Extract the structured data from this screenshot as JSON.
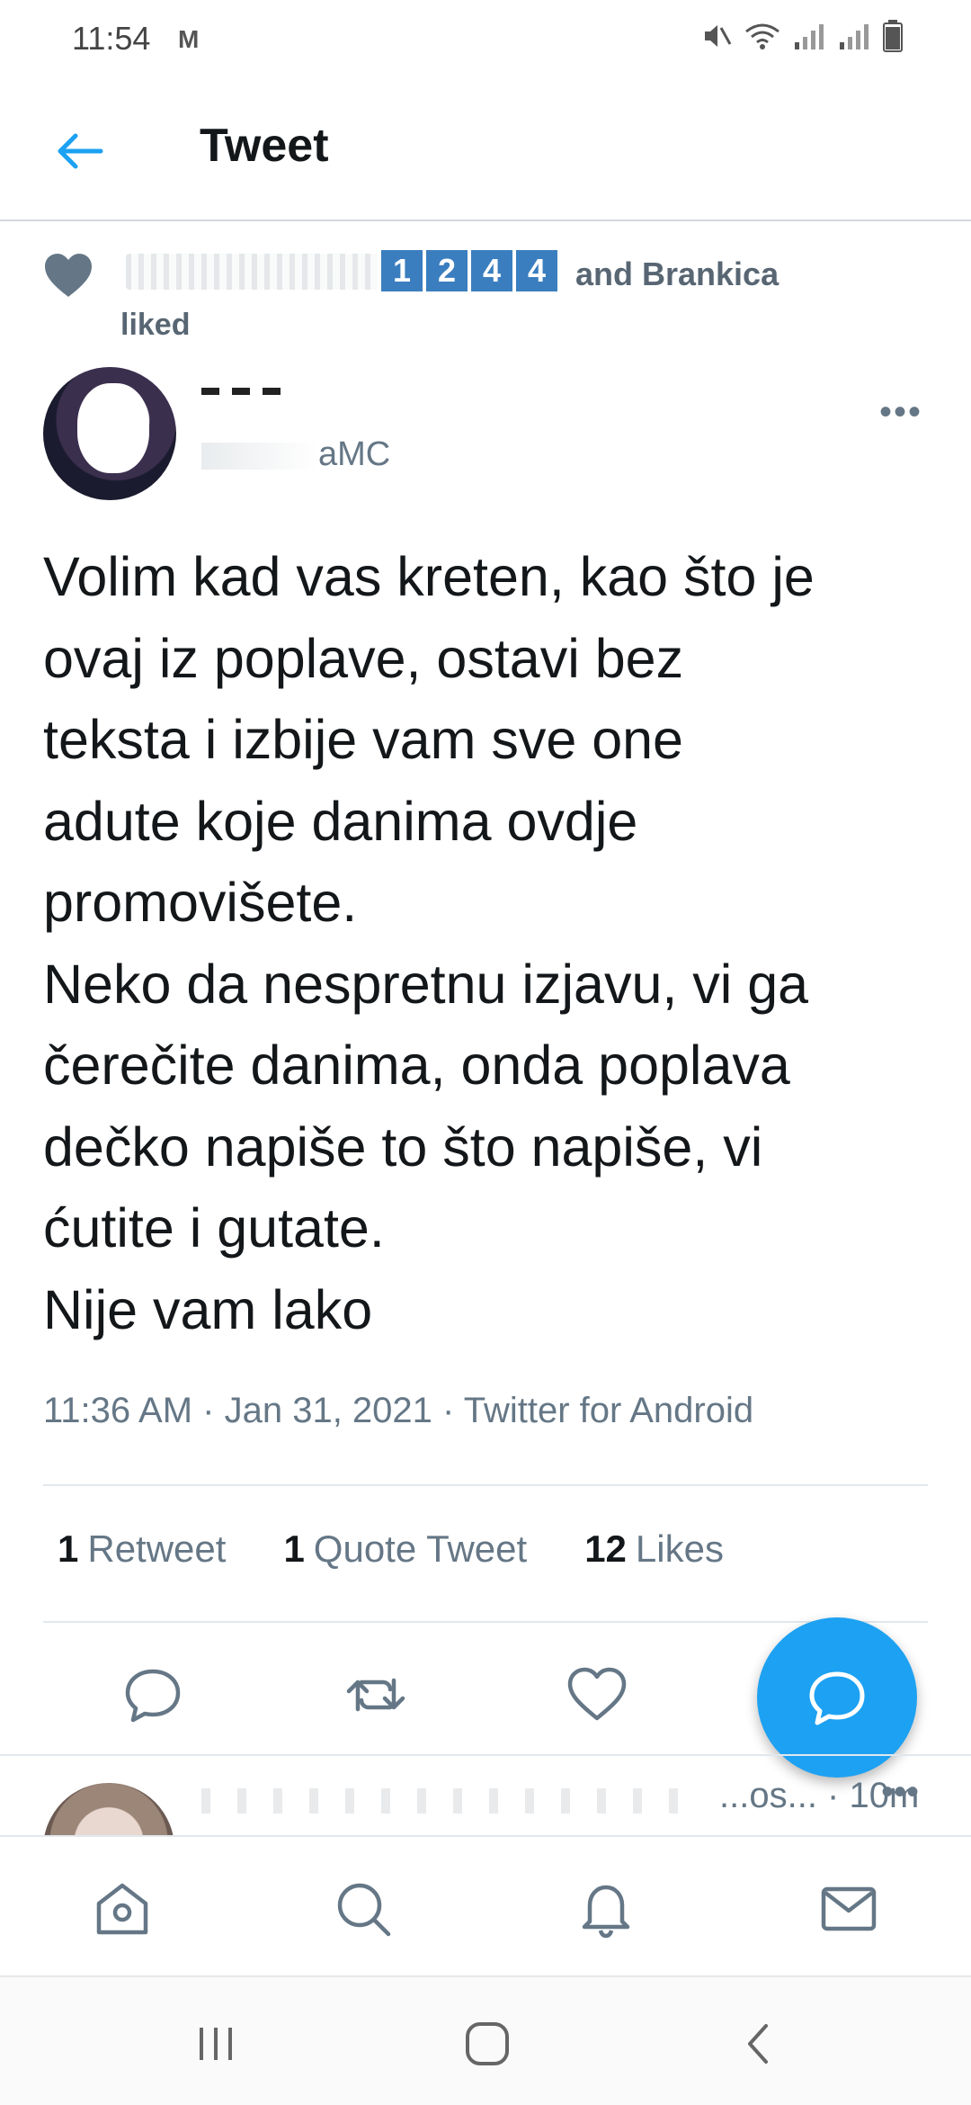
{
  "status_bar": {
    "time": "11:54",
    "mail_icon": "M",
    "icons": [
      "mute-icon",
      "wifi-icon",
      "signal-icon",
      "signal-icon",
      "battery-icon"
    ]
  },
  "header": {
    "title": "Tweet",
    "back_icon": "arrow-left-icon"
  },
  "social_context": {
    "badges": [
      "1",
      "2",
      "4",
      "4"
    ],
    "text": "and Brankica",
    "liked": "liked"
  },
  "tweet": {
    "handle_suffix": "aMC",
    "text": "Volim kad vas kreten, kao što je\novaj iz poplave, ostavi bez\nteksta i izbije vam sve one\nadute koje danima ovdje\npromovišete.\nNeko da nespretnu izjavu, vi ga\nčerečite danima, onda poplava\ndečko napiše to što napiše, vi\nćutite i gutate.\nNije vam lako",
    "time": "11:36 AM",
    "date": "Jan 31, 2021",
    "source": "Twitter for Android",
    "stats": [
      {
        "num": "1",
        "label": "Retweet"
      },
      {
        "num": "1",
        "label": "Quote Tweet"
      },
      {
        "num": "12",
        "label": "Likes"
      }
    ]
  },
  "reply_preview": {
    "handle": "...os...",
    "time": "10m"
  },
  "colors": {
    "accent": "#1da1f2",
    "text_primary": "#14171a",
    "text_secondary": "#657786",
    "divider": "#e1e8ed",
    "badge": "#3a7ebf"
  }
}
